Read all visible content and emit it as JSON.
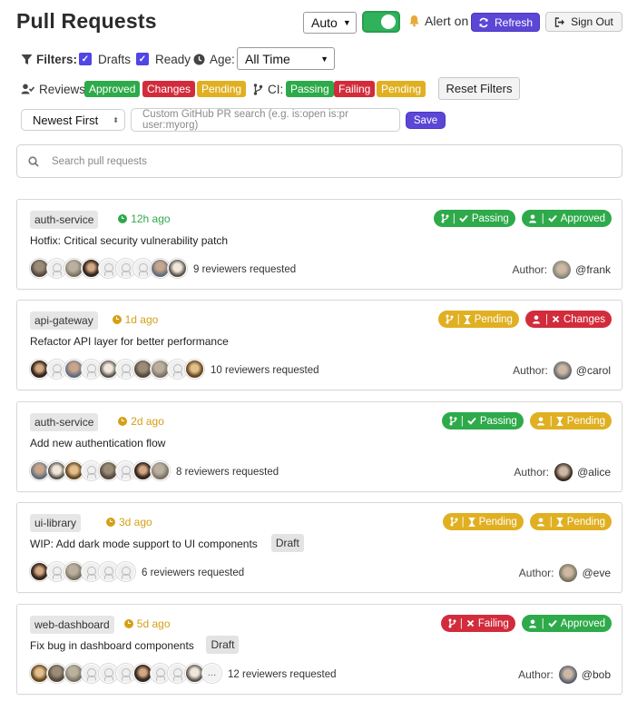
{
  "header": {
    "title": "Pull Requests",
    "mode_select": "Auto",
    "alert_label": "Alert on",
    "refresh_label": "Refresh",
    "signout_label": "Sign Out"
  },
  "filters": {
    "label": "Filters:",
    "drafts_label": "Drafts",
    "ready_label": "Ready",
    "age_label": "Age:",
    "age_value": "All Time",
    "reviews_label": "Reviews:",
    "review_chips": [
      "Approved",
      "Changes",
      "Pending"
    ],
    "ci_label": "CI:",
    "ci_chips": [
      "Passing",
      "Failing",
      "Pending"
    ],
    "reset_label": "Reset Filters",
    "sort_value": "Newest First",
    "custom_search_placeholder": "Custom GitHub PR search (e.g. is:open is:pr user:myorg)",
    "save_label": "Save"
  },
  "search": {
    "placeholder": "Search pull requests"
  },
  "colors": {
    "green": "#2eaa4a",
    "red": "#d22c3c",
    "yellow": "#e0b022",
    "primary": "#5b46d6"
  },
  "prs": [
    {
      "repo": "auth-service",
      "age": "12h ago",
      "age_status": "green",
      "title": "Hotfix: Critical security vulnerability patch",
      "draft": "",
      "ci": {
        "status": "green",
        "icon": "check",
        "text": "Passing"
      },
      "review": {
        "status": "green",
        "icon": "check",
        "text": "Approved"
      },
      "avatars": [
        "p1",
        "gh",
        "p2",
        "p3",
        "gh",
        "gh",
        "gh",
        "p4",
        "p5"
      ],
      "reviewers": "9 reviewers requested",
      "author_label": "Author:",
      "author": "@frank",
      "author_color": "#8a8a7a"
    },
    {
      "repo": "api-gateway",
      "age": "1d ago",
      "age_status": "yellow",
      "title": "Refactor API layer for better performance",
      "draft": "",
      "ci": {
        "status": "yellow",
        "icon": "hourglass",
        "text": "Pending"
      },
      "review": {
        "status": "red",
        "icon": "x",
        "text": "Changes"
      },
      "avatars": [
        "p3",
        "gh",
        "p4",
        "gh",
        "p5",
        "gh",
        "p1",
        "p2",
        "gh",
        "p6"
      ],
      "reviewers": "10 reviewers requested",
      "author_label": "Author:",
      "author": "@carol",
      "author_color": "#6c6f73"
    },
    {
      "repo": "auth-service",
      "age": "2d ago",
      "age_status": "yellow",
      "title": "Add new authentication flow",
      "draft": "",
      "ci": {
        "status": "green",
        "icon": "check",
        "text": "Passing"
      },
      "review": {
        "status": "yellow",
        "icon": "hourglass",
        "text": "Pending"
      },
      "avatars": [
        "p4",
        "p5",
        "p6",
        "gh",
        "p1",
        "gh",
        "p3",
        "p2"
      ],
      "reviewers": "8 reviewers requested",
      "author_label": "Author:",
      "author": "@alice",
      "author_color": "#3a2a22"
    },
    {
      "repo": "ui-library",
      "age": "3d ago",
      "age_status": "yellow",
      "title": "WIP: Add dark mode support to UI components",
      "draft": "Draft",
      "ci": {
        "status": "yellow",
        "icon": "hourglass",
        "text": "Pending"
      },
      "review": {
        "status": "yellow",
        "icon": "hourglass",
        "text": "Pending"
      },
      "avatars": [
        "p3",
        "gh",
        "p2",
        "gh",
        "gh",
        "gh"
      ],
      "reviewers": "6 reviewers requested",
      "author_label": "Author:",
      "author": "@eve",
      "author_color": "#7d7a63"
    },
    {
      "repo": "web-dashboard",
      "age": "5d ago",
      "age_status": "yellow",
      "title": "Fix bug in dashboard components",
      "draft": "Draft",
      "ci": {
        "status": "red",
        "icon": "x",
        "text": "Failing"
      },
      "review": {
        "status": "green",
        "icon": "check",
        "text": "Approved"
      },
      "avatars": [
        "p6",
        "p1",
        "p2",
        "gh",
        "gh",
        "gh",
        "p3",
        "gh",
        "gh",
        "p5",
        "more"
      ],
      "reviewers": "12 reviewers requested",
      "author_label": "Author:",
      "author": "@bob",
      "author_color": "#5e6470"
    }
  ]
}
